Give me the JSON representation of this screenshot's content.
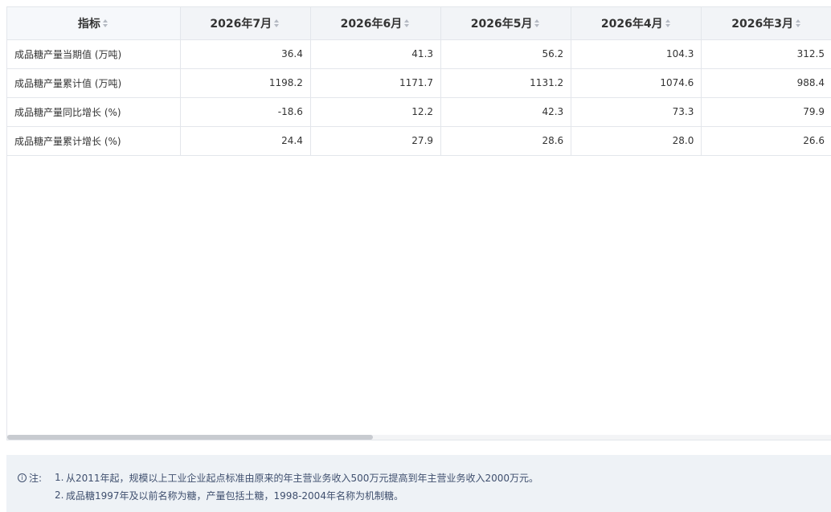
{
  "table": {
    "headers": [
      "指标",
      "2026年7月",
      "2026年6月",
      "2026年5月",
      "2026年4月",
      "2026年3月"
    ],
    "rows": [
      [
        "成品糖产量当期值 (万吨)",
        "36.4",
        "41.3",
        "56.2",
        "104.3",
        "312.5"
      ],
      [
        "成品糖产量累计值 (万吨)",
        "1198.2",
        "1171.7",
        "1131.2",
        "1074.6",
        "988.4"
      ],
      [
        "成品糖产量同比增长 (%)",
        "-18.6",
        "12.2",
        "42.3",
        "73.3",
        "79.9"
      ],
      [
        "成品糖产量累计增长 (%)",
        "24.4",
        "27.9",
        "28.6",
        "28.0",
        "26.6"
      ]
    ]
  },
  "icons": {
    "sort": "sort-icon",
    "info": "info-icon"
  },
  "notes": {
    "label": "注:",
    "items": [
      {
        "num": "1.",
        "text": "从2011年起，规模以上工业企业起点标准由原来的年主营业务收入500万元提高到年主营业务收入2000万元。"
      },
      {
        "num": "2.",
        "text": "成品糖1997年及以前名称为糖，产量包括土糖，1998-2004年名称为机制糖。"
      }
    ]
  },
  "colors": {
    "header_bg": "#f2f4f7",
    "border": "#e3e6eb",
    "note_bg": "#eef2f6",
    "note_text": "#3f4f6e"
  }
}
